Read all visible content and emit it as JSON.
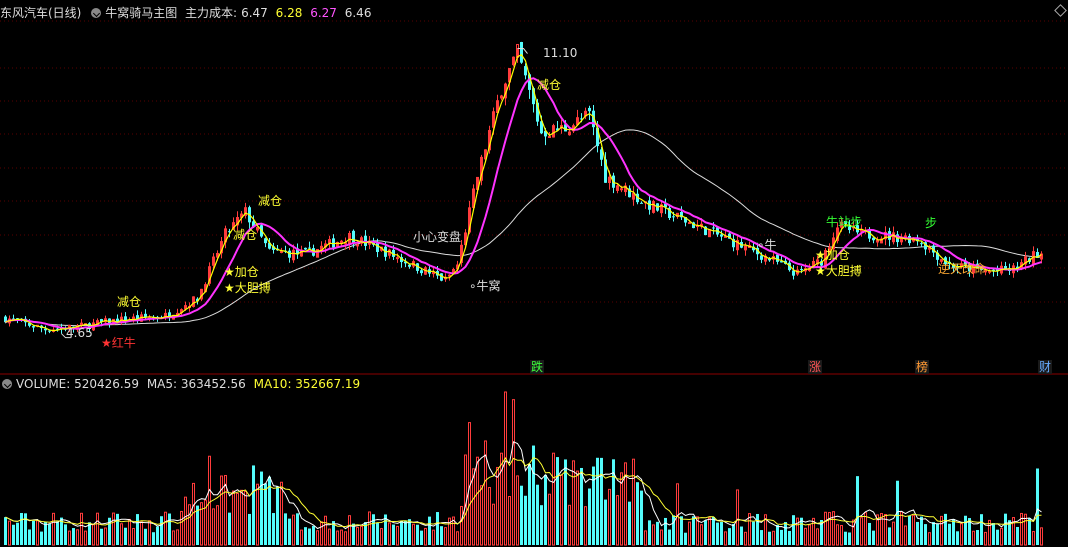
{
  "header": {
    "stock": "东风汽车(日线)",
    "indicator": "牛窝骑马主图",
    "cost_label": "主力成本:",
    "v1": "6.47",
    "v2": "6.28",
    "v3": "6.27",
    "v4": "6.46"
  },
  "volume_header": {
    "volume": "VOLUME: 520426.59",
    "ma5": "MA5: 363452.56",
    "ma10": "MA10: 352667.19"
  },
  "tags": [
    "跌",
    "涨",
    "榜",
    "财"
  ],
  "annotations": {
    "high": "11.10",
    "low": "4.65",
    "red_niu": "★红牛",
    "jiancang1": "减仓",
    "jiancang2": "减仓",
    "jiancang3": "减仓",
    "jiancang4": "减仓",
    "jiacang1": "★加仓",
    "dadanbo1": "★大胆搏",
    "jiacang2": "★加仓",
    "dadanbo2": "★大胆搏",
    "xiaoxin": "小心变盘",
    "niuwo1": "∘牛窝",
    "niuwo2": "∘牛",
    "niuzhan": "牛站步",
    "jibu": "步",
    "nitian": "逆天改命"
  },
  "colors": {
    "up": "#ff3c3c",
    "down": "#54fcfc",
    "ma_main": "#ff33ff",
    "ma_short": "#ffff00",
    "ma_long": "#dddddd",
    "vol_ma5": "#ffffff",
    "vol_ma10": "#ffff33"
  },
  "chart_data": {
    "type": "candlestick",
    "price_range": [
      4.1,
      11.7
    ],
    "volume_max": 560000,
    "anchors": [
      [
        0,
        5.0
      ],
      [
        10,
        4.75
      ],
      [
        18,
        4.8
      ],
      [
        28,
        4.95
      ],
      [
        40,
        5.05
      ],
      [
        48,
        5.45
      ],
      [
        55,
        6.9
      ],
      [
        60,
        7.4
      ],
      [
        66,
        6.5
      ],
      [
        75,
        6.45
      ],
      [
        86,
        6.85
      ],
      [
        95,
        6.5
      ],
      [
        110,
        5.85
      ],
      [
        113,
        6.2
      ],
      [
        118,
        8.2
      ],
      [
        124,
        10.2
      ],
      [
        128,
        11.0
      ],
      [
        134,
        9.2
      ],
      [
        140,
        9.3
      ],
      [
        146,
        9.6
      ],
      [
        150,
        8.2
      ],
      [
        160,
        7.6
      ],
      [
        170,
        7.2
      ],
      [
        180,
        6.8
      ],
      [
        192,
        6.3
      ],
      [
        198,
        6.0
      ],
      [
        204,
        6.3
      ],
      [
        208,
        7.1
      ],
      [
        214,
        6.9
      ],
      [
        228,
        6.8
      ],
      [
        236,
        6.2
      ],
      [
        246,
        6.05
      ],
      [
        252,
        6.1
      ],
      [
        258,
        6.47
      ]
    ],
    "volume_spikes": [
      [
        51,
        0.58
      ],
      [
        62,
        0.52
      ],
      [
        64,
        0.48
      ],
      [
        116,
        0.8
      ],
      [
        120,
        0.68
      ],
      [
        125,
        1.0
      ],
      [
        127,
        0.95
      ],
      [
        132,
        0.65
      ],
      [
        137,
        0.6
      ],
      [
        142,
        0.55
      ],
      [
        148,
        0.57
      ],
      [
        152,
        0.56
      ],
      [
        168,
        0.4
      ],
      [
        183,
        0.36
      ],
      [
        213,
        0.45
      ],
      [
        223,
        0.42
      ],
      [
        258,
        0.5
      ]
    ],
    "high_price": 11.1,
    "low_price": 4.65
  }
}
